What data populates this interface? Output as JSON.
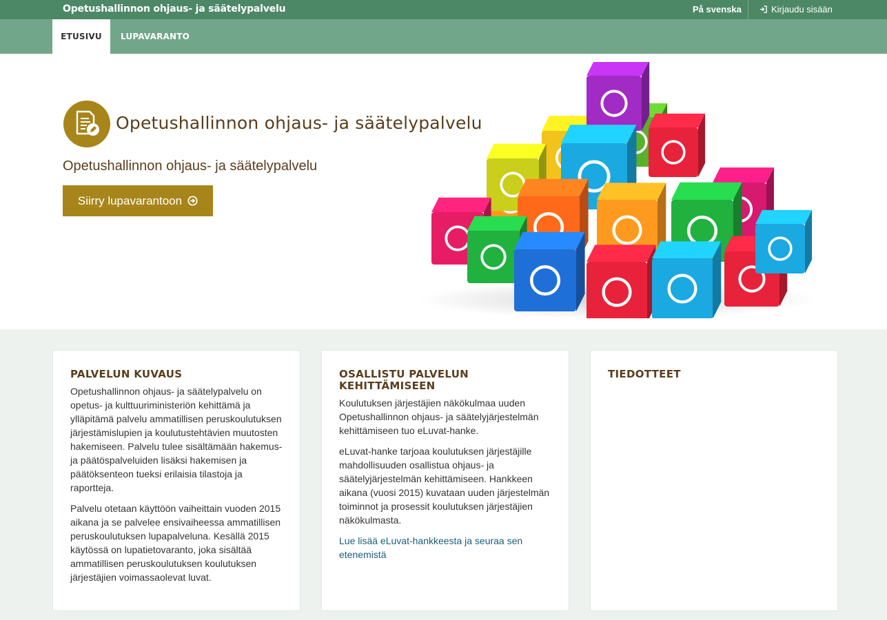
{
  "header": {
    "site_title": "Opetushallinnon ohjaus- ja säätelypalvelu",
    "language_link": "På svenska",
    "login_link": "Kirjaudu sisään",
    "login_icon": "sign-in-icon"
  },
  "nav": {
    "tabs": [
      {
        "label": "ETUSIVU",
        "active": true
      },
      {
        "label": "LUPAVARANTO",
        "active": false
      }
    ]
  },
  "hero": {
    "title": "Opetushallinnon ohjaus- ja säätelypalvelu",
    "subtitle": "Opetushallinnon ohjaus- ja säätelypalvelu",
    "button_label": "Siirry lupavarantoon",
    "button_icon": "arrow-circle-right-icon",
    "logo_icon": "document-edit-icon",
    "image": "colorful-app-icon-cubes"
  },
  "cards": [
    {
      "heading": "PALVELUN KUVAUS",
      "paragraphs": [
        "Opetushallinnon ohjaus- ja säätelypalvelu on opetus- ja kulttuuriministeriön kehittämä ja ylläpitämä palvelu ammatillisen peruskoulutuksen järjestämislupien ja koulutustehtävien muutosten hakemiseen. Palvelu tulee sisältämään hakemus- ja päätöspalveluiden lisäksi hakemisen ja päätöksenteon tueksi erilaisia tilastoja ja raportteja.",
        "Palvelu otetaan käyttöön vaiheittain vuoden 2015 aikana ja se palvelee ensivaiheessa ammatillisen peruskoulutuksen lupapalveluna. Kesällä 2015 käytössä on lupatietovaranto, joka sisältää ammatillisen peruskoulutuksen koulutuksen järjestäjien voimassaolevat luvat."
      ]
    },
    {
      "heading": "OSALLISTU PALVELUN KEHITTÄMISEEN",
      "paragraphs": [
        "Koulutuksen järjestäjien näkökulmaa uuden Opetushallinnon ohjaus- ja säätelyjärjestelmän kehittämiseen tuo eLuvat-hanke.",
        "eLuvat-hanke tarjoaa koulutuksen järjestäjille mahdollisuuden osallistua ohjaus- ja säätelyjärjestelmän kehittämiseen. Hankkeen aikana (vuosi 2015) kuvataan uuden järjestelmän toiminnot ja prosessit koulutuksen järjestäjien näkökulmasta."
      ],
      "link": "Lue lisää eLuvat-hankkeesta ja seuraa sen etenemistä"
    },
    {
      "heading": "TIEDOTTEET"
    }
  ],
  "colors": {
    "topbar": "#4d8866",
    "navbar": "#72a68a",
    "accent_gold": "#a8851a",
    "heading_brown": "#5a3d1d",
    "link_blue": "#1b5d7a",
    "page_bg": "#edf2ef"
  }
}
